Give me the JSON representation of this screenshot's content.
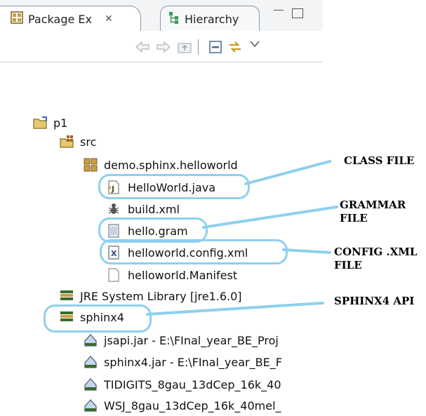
{
  "tabs": {
    "package_label": "Package Ex",
    "package_close": "✕",
    "hierarchy_label": "Hierarchy"
  },
  "tree": {
    "rows": [
      {
        "label": "p1"
      },
      {
        "label": "src"
      },
      {
        "label": "demo.sphinx.helloworld"
      },
      {
        "label": "HelloWorld.java"
      },
      {
        "label": "build.xml"
      },
      {
        "label": "hello.gram"
      },
      {
        "label": "helloworld.config.xml"
      },
      {
        "label": "helloworld.Manifest"
      },
      {
        "label": "JRE System Library [jre1.6.0]"
      },
      {
        "label": "sphinx4"
      },
      {
        "label": "jsapi.jar - E:\\FInal_year_BE_Proj"
      },
      {
        "label": "sphinx4.jar - E:\\FInal_year_BE_F"
      },
      {
        "label": "TIDIGITS_8gau_13dCep_16k_40"
      },
      {
        "label": "WSJ_8gau_13dCep_16k_40mel_"
      }
    ]
  },
  "annotations": {
    "class_file": "CLASS FILE",
    "grammar_file_1": "GRAMMAR",
    "grammar_file_2": "FILE",
    "config_file_1": "CONFIG .XML",
    "config_file_2": "FILE",
    "sphinx_api": "SPHINX4 API"
  },
  "colors": {
    "highlight": "#8ed0ee",
    "package_icon": "#c8a040",
    "jar_icon": "#5a7fa8"
  }
}
